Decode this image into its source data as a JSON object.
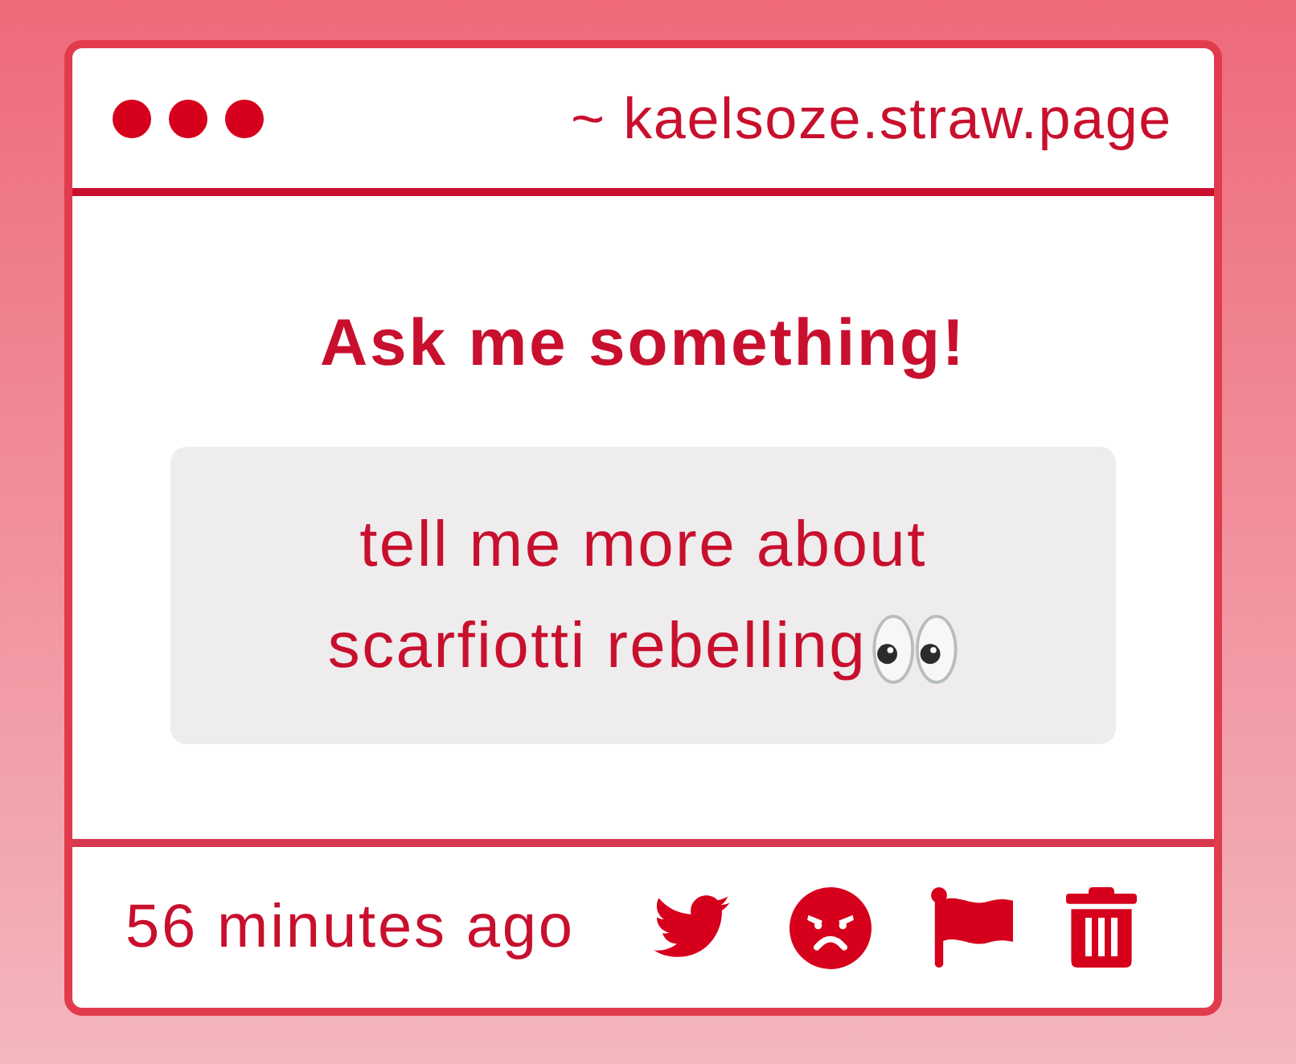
{
  "window": {
    "address": "~ kaelsoze.straw.page"
  },
  "prompt": {
    "title": "Ask me something!"
  },
  "question": {
    "lines": [
      "tell me more about",
      "scarfiotti rebelling"
    ]
  },
  "footer": {
    "time": "56 minutes ago"
  }
}
